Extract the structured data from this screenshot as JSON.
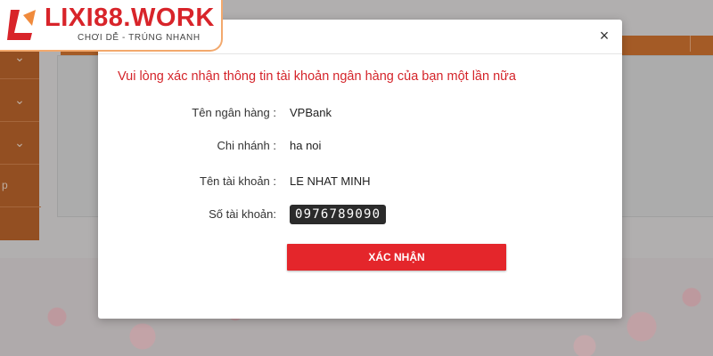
{
  "logo": {
    "brand": "LIXI88.WORK",
    "slogan": "CHƠI DỄ - TRÚNG NHANH"
  },
  "background": {
    "sidebar_items": [
      {
        "icon": "chevron-down-icon",
        "glyph": "⌄"
      },
      {
        "icon": "chevron-down-icon",
        "glyph": "⌄"
      },
      {
        "icon": "chevron-down-icon",
        "glyph": "⌄"
      },
      {
        "text": "p"
      }
    ]
  },
  "modal": {
    "close_glyph": "×",
    "title": "Vui lòng xác nhận thông tin tài khoản ngân hàng của bạn một lần nữa",
    "fields": {
      "bank_name": {
        "label": "Tên ngân hàng :",
        "value": "VPBank"
      },
      "branch": {
        "label": "Chi nhánh :",
        "value": "ha noi"
      },
      "account_name": {
        "label": "Tên tài khoản :",
        "value": "LE NHAT MINH"
      },
      "account_number": {
        "label": "Số tài khoản:",
        "value": "0976789090"
      }
    },
    "confirm_label": "XÁC NHẬN"
  },
  "colors": {
    "accent_red": "#e4262b",
    "title_red": "#d4242a",
    "sidebar_orange": "#b0561a"
  }
}
